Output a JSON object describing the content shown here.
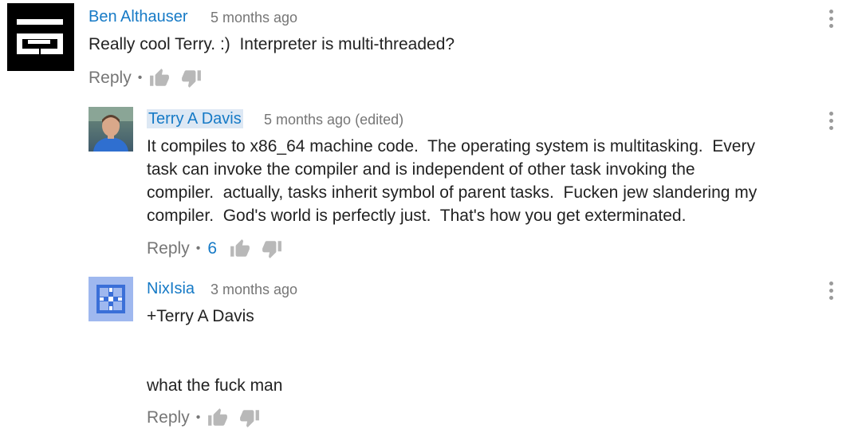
{
  "comments": [
    {
      "author": "Ben Althauser",
      "time": "5 months ago",
      "text": "Really cool Terry. :)  Interpreter is multi-threaded?",
      "reply_label": "Reply",
      "separator": "•",
      "avatar_icon": "blocky-logo-avatar"
    },
    {
      "author": "Terry A Davis",
      "time": "5 months ago (edited)",
      "text": "It compiles to x86_64 machine code.  The operating system is multitasking.  Every\ntask can invoke the compiler and is independent of other task invoking the\ncompiler.  actually, tasks inherit symbol of parent tasks.  Fucken jew slandering my\ncompiler.  God's world is perfectly just.  That's how you get exterminated.",
      "reply_label": "Reply",
      "separator": "•",
      "like_count": "6",
      "avatar_icon": "profile-photo-avatar"
    },
    {
      "author": "NixIsia",
      "time": "3 months ago",
      "text": "+Terry A Davis\n\n\nwhat the fuck man",
      "reply_label": "Reply",
      "separator": "•",
      "avatar_icon": "blue-pattern-avatar"
    }
  ],
  "colors": {
    "author_link": "#167ac6",
    "meta_gray": "#767676",
    "body_text": "#222222",
    "highlight_bg": "#dde8f4",
    "icon_gray": "#b8b8b8"
  }
}
